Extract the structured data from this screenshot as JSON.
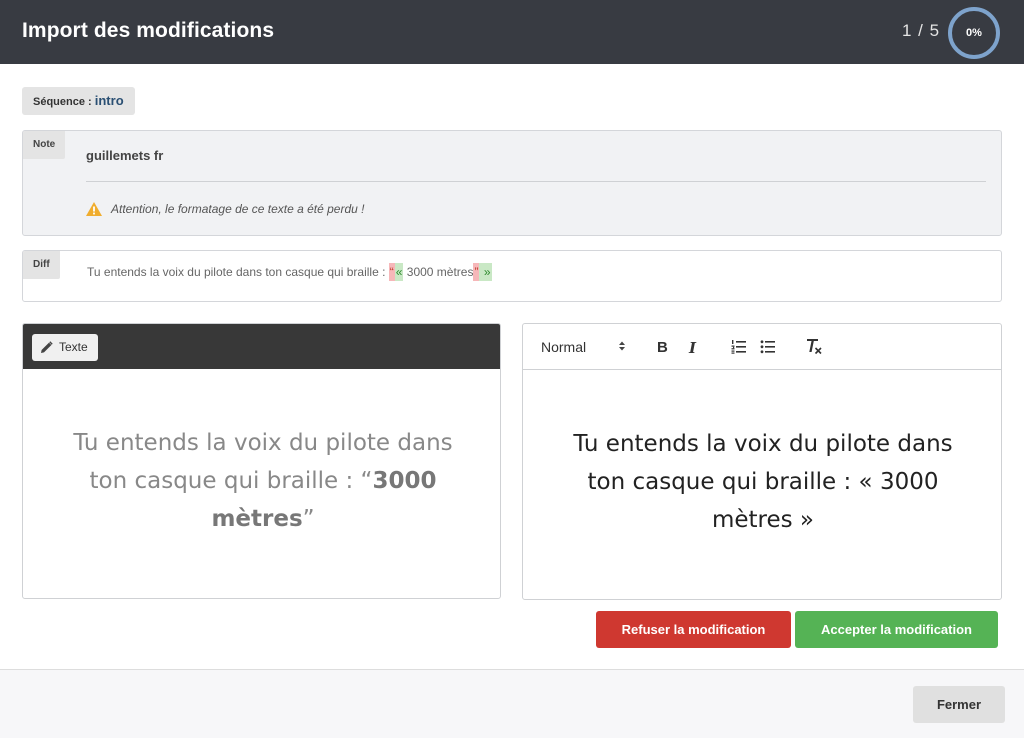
{
  "header": {
    "title": "Import des modifications",
    "pager": "1 / 5",
    "progress_label": "0%",
    "progress_value": 0
  },
  "sequence": {
    "label": "Séquence :",
    "value": "intro"
  },
  "note": {
    "tag": "Note",
    "title": "guillemets fr",
    "warning": "Attention, le formatage de ce texte a été perdu !"
  },
  "diff": {
    "tag": "Diff",
    "prefix": "Tu entends la voix du pilote dans ton casque qui braille : ",
    "del_open": "“",
    "ins_open": "«",
    "middle": " 3000 mètres",
    "del_close": "”",
    "ins_close": " »"
  },
  "editor_left": {
    "button_label": "Texte",
    "text_plain": "Tu entends la voix du pilote dans ton casque qui braille : “",
    "text_bold": "3000 mètres",
    "text_end": "”"
  },
  "editor_right": {
    "format_select": "Normal",
    "text": "Tu entends la voix du pilote dans ton casque qui braille : « 3000 mètres »"
  },
  "actions": {
    "refuse_label": "Refuser la modification",
    "accept_label": "Accepter la modification",
    "close_label": "Fermer"
  },
  "colors": {
    "header_bg": "#383b42",
    "refuse": "#cf3830",
    "accept": "#55b355",
    "progress_ring": "#7ea3cc"
  },
  "icons": {
    "warning": "warning-icon",
    "edit": "pencil-icon",
    "bold": "bold-icon",
    "italic": "italic-icon",
    "ordered_list": "ordered-list-icon",
    "bullet_list": "bullet-list-icon",
    "clear_format": "clear-format-icon"
  }
}
